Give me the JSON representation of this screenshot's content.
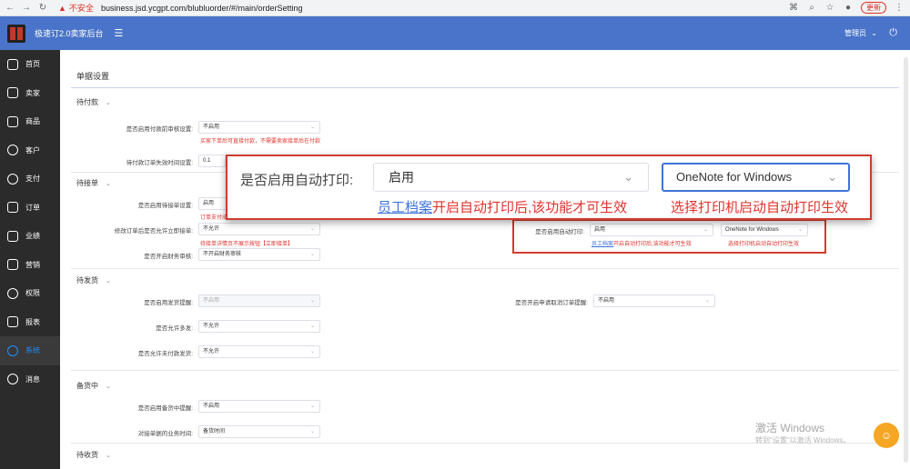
{
  "browser": {
    "insecure": "不安全",
    "url": "business.jsd.ycgpt.com/blubluorder/#/main/orderSetting",
    "update_label": "更新"
  },
  "header": {
    "app_title": "极速订2.0卖家后台",
    "user": "管理员"
  },
  "sidebar": {
    "items": [
      {
        "label": "首页",
        "icon": "home-icon"
      },
      {
        "label": "卖家",
        "icon": "store-icon"
      },
      {
        "label": "商品",
        "icon": "bag-icon"
      },
      {
        "label": "客户",
        "icon": "customer-icon"
      },
      {
        "label": "支付",
        "icon": "pay-icon"
      },
      {
        "label": "订单",
        "icon": "order-icon"
      },
      {
        "label": "业绩",
        "icon": "trophy-icon"
      },
      {
        "label": "营销",
        "icon": "gift-icon"
      },
      {
        "label": "权限",
        "icon": "key-icon"
      },
      {
        "label": "报表",
        "icon": "report-icon"
      },
      {
        "label": "系统",
        "icon": "gear-icon"
      },
      {
        "label": "消息",
        "icon": "bell-icon"
      }
    ]
  },
  "page": {
    "title": "单据设置"
  },
  "sections": {
    "pending_payment": {
      "title": "待付款",
      "payment_review_label": "是否启用付款前审核设置:",
      "payment_review_value": "不启用",
      "payment_review_hint": "买家下单后可直接付款，不需要卖家接单后在付款",
      "unpaid_expiry_label": "待付款订单失效时间设置:",
      "unpaid_expiry_value": "0.1"
    },
    "pending_accept": {
      "title": "待接单",
      "accept_review_label": "是否启用待接单设置:",
      "accept_review_value": "启用",
      "accept_review_hint": "订单支付成功后",
      "modify_label": "修改订单后是否允许立即接单:",
      "modify_value": "不允许",
      "modify_hint": "待接单详情页不展示按钮【立即接单】",
      "finance_review_label": "是否开启财务审核:",
      "finance_review_value": "不开启财务审核",
      "auto_print_label": "是否启用自动打印:",
      "auto_print_value": "启用",
      "printer_value": "OneNote for Windows",
      "auto_print_link": "员工档案",
      "auto_print_hint": "开启自动打印后,该功能才可生效",
      "printer_hint": "选择打印机启动自动打印生效"
    },
    "pending_ship": {
      "title": "待发货",
      "ship_reminder_label": "是否启用发货提醒:",
      "ship_reminder_value": "不启用",
      "cancel_reminder_label": "是否开启申请取消订单提醒:",
      "cancel_reminder_value": "不启用",
      "multi_ship_label": "是否允许多发:",
      "multi_ship_value": "不允许",
      "unpaid_ship_label": "是否允许未付款发货:",
      "unpaid_ship_value": "不允许"
    },
    "stocking": {
      "title": "备货中",
      "stock_reminder_label": "是否启用备货中提醒:",
      "stock_reminder_value": "不启用",
      "business_time_label": "对接单据的业务时间:",
      "business_time_value": "备货时间"
    },
    "pending_receive": {
      "title": "待收货"
    }
  },
  "watermark": {
    "line1": "激活 Windows",
    "line2": "转到\"设置\"以激活 Windows。"
  }
}
